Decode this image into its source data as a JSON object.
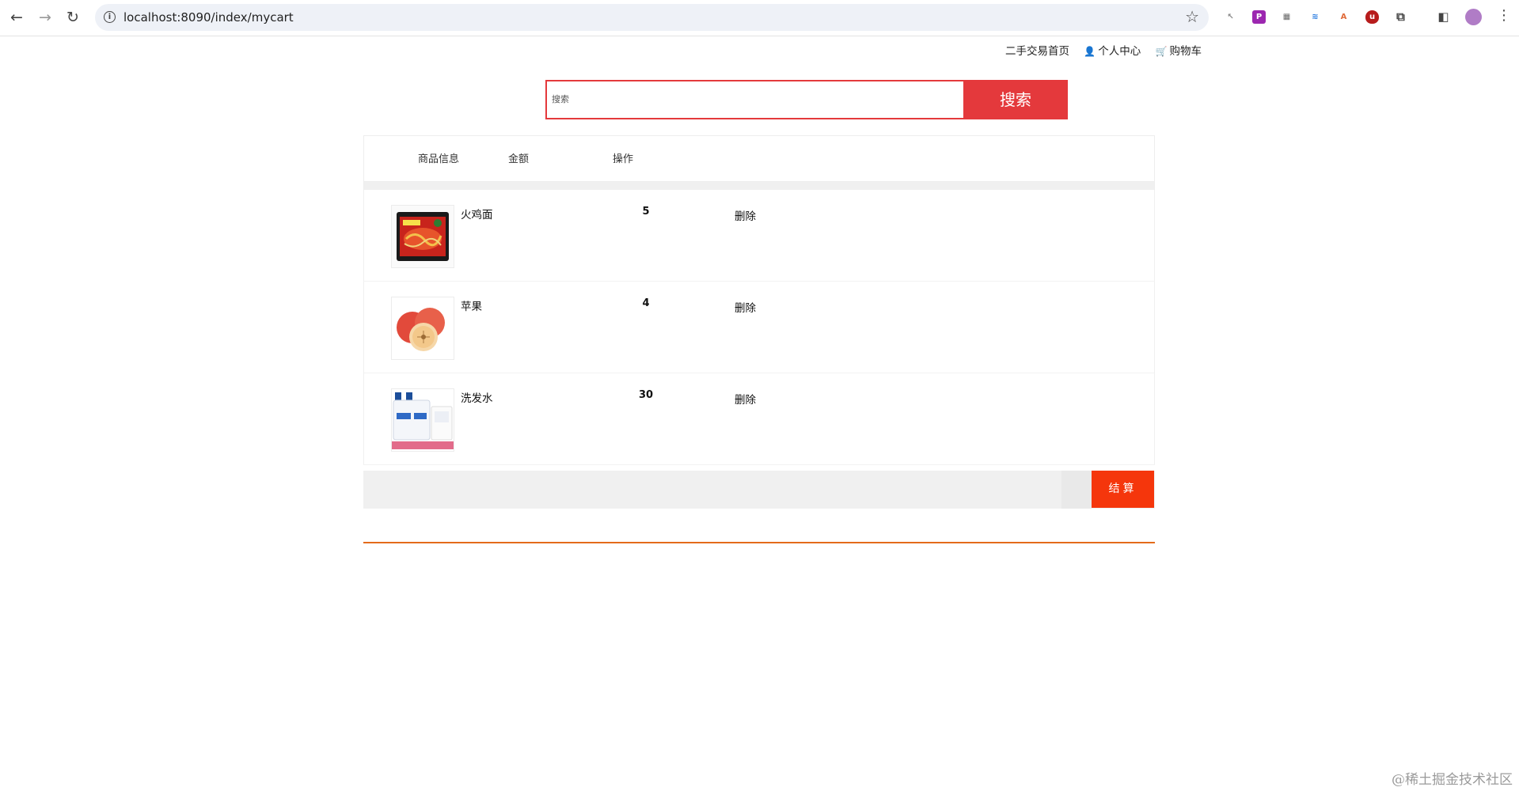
{
  "browser": {
    "url": "localhost:8090/index/mycart",
    "back_icon": "arrow-left",
    "forward_icon": "arrow-right",
    "reload_icon": "reload"
  },
  "topnav": {
    "home": "二手交易首页",
    "profile": "个人中心",
    "cart": "购物车"
  },
  "search": {
    "placeholder": "搜索",
    "button": "搜索"
  },
  "cart": {
    "headers": {
      "info": "商品信息",
      "amount": "金额",
      "action": "操作"
    },
    "items": [
      {
        "name": "火鸡面",
        "amount": "5",
        "action": "删除"
      },
      {
        "name": "苹果",
        "amount": "4",
        "action": "删除"
      },
      {
        "name": "洗发水",
        "amount": "30",
        "action": "删除"
      }
    ],
    "checkout": "结算"
  },
  "colors": {
    "accent_red": "#e4393c",
    "checkout_orange": "#f5360c",
    "divider_orange": "#e36b1b"
  },
  "watermark": "@稀土掘金技术社区"
}
